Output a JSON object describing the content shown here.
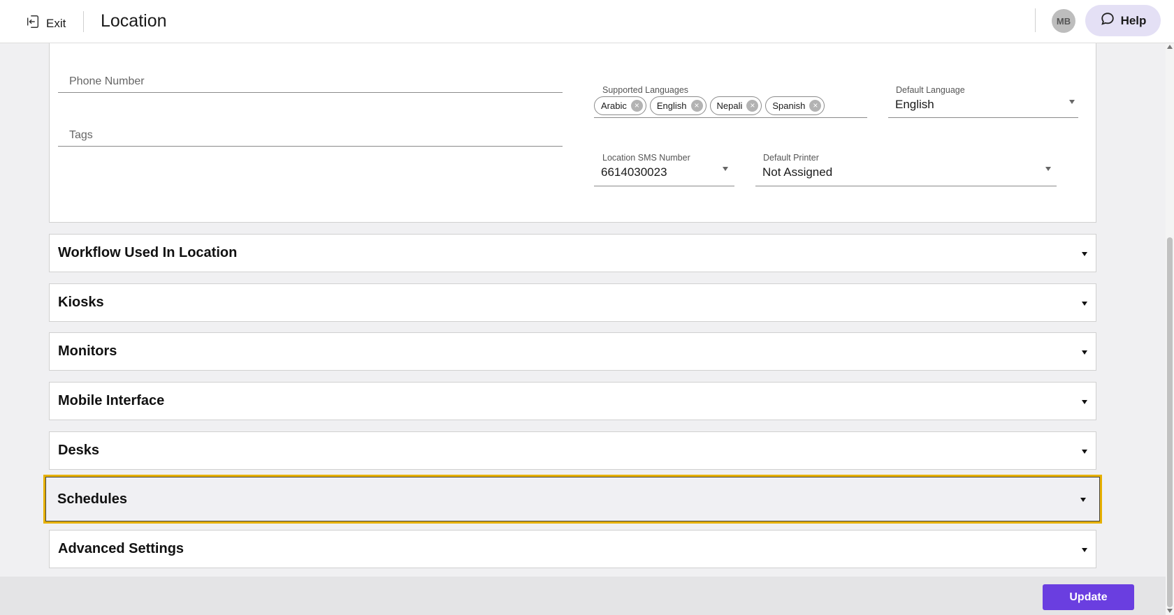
{
  "header": {
    "exit_label": "Exit",
    "title": "Location",
    "avatar_initials": "MB",
    "help_label": "Help"
  },
  "form": {
    "phone_number": {
      "placeholder": "Phone Number",
      "value": ""
    },
    "tags": {
      "placeholder": "Tags",
      "value": ""
    },
    "supported_languages": {
      "label": "Supported Languages",
      "chips": [
        "Arabic",
        "English",
        "Nepali",
        "Spanish"
      ]
    },
    "default_language": {
      "label": "Default Language",
      "value": "English"
    },
    "location_sms_number": {
      "label": "Location SMS Number",
      "value": "6614030023"
    },
    "default_printer": {
      "label": "Default Printer",
      "value": "Not Assigned"
    }
  },
  "sections": [
    {
      "title": "Workflow Used In Location",
      "highlighted": false
    },
    {
      "title": "Kiosks",
      "highlighted": false
    },
    {
      "title": "Monitors",
      "highlighted": false
    },
    {
      "title": "Mobile Interface",
      "highlighted": false
    },
    {
      "title": "Desks",
      "highlighted": false
    },
    {
      "title": "Schedules",
      "highlighted": true
    },
    {
      "title": "Advanced Settings",
      "highlighted": false
    }
  ],
  "footer": {
    "update_label": "Update"
  },
  "colors": {
    "accent": "#6a3ee0",
    "help_bg": "#e4e0f5",
    "highlight_border": "#e6b000"
  },
  "icons": {
    "exit": "exit-icon",
    "help": "chat-bubble-icon",
    "chip_remove": "close-circle-icon",
    "dropdown": "caret-down-icon"
  }
}
